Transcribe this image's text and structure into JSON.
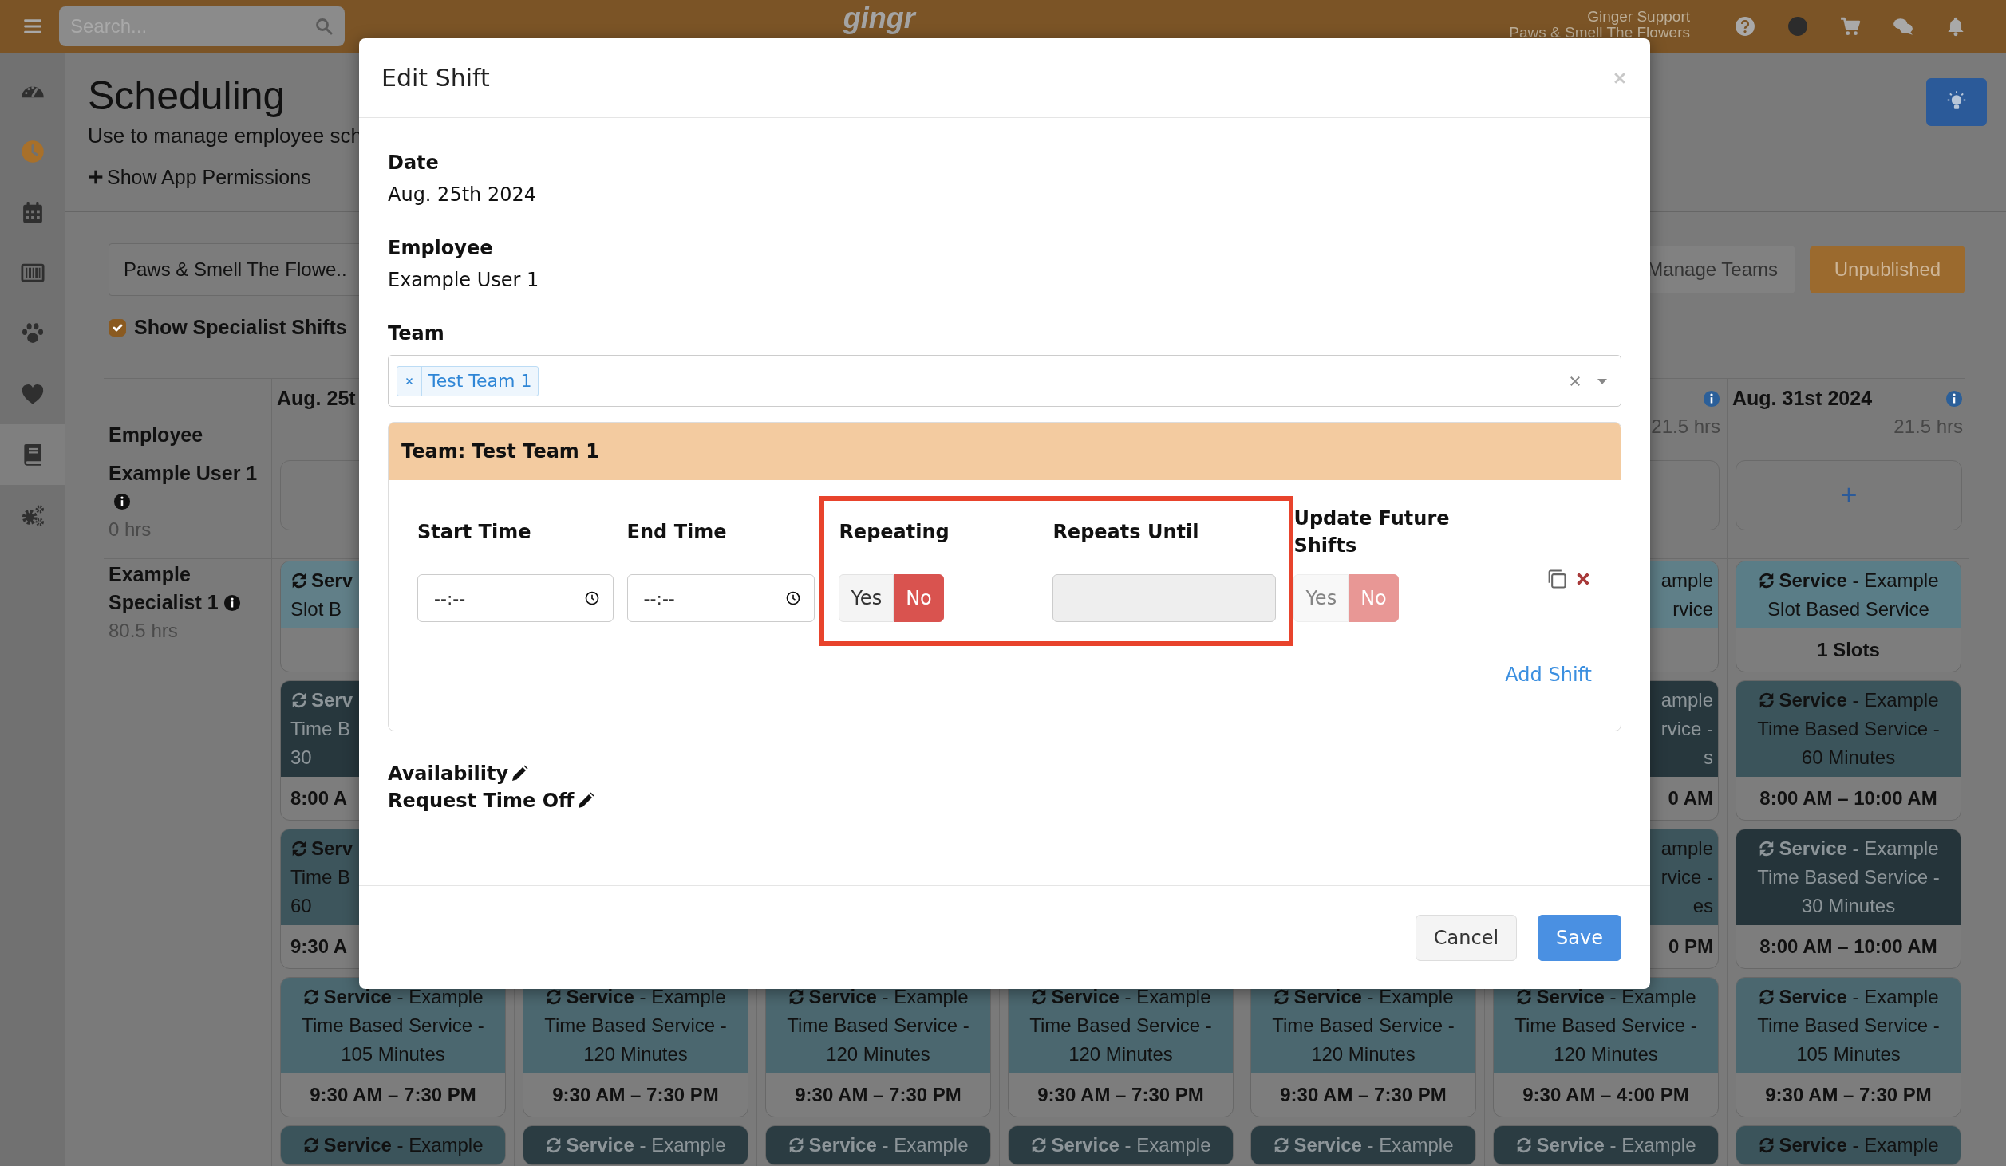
{
  "navbar": {
    "search": {
      "placeholder": "Search..."
    },
    "logo": "gingr",
    "account": {
      "name": "Ginger Support",
      "location": "Paws & Smell The Flowers"
    },
    "icons": [
      {
        "kind": "help"
      },
      {
        "kind": "avatar"
      },
      {
        "kind": "cart"
      },
      {
        "kind": "chat"
      },
      {
        "kind": "bell"
      }
    ]
  },
  "sidebar": {
    "items": [
      {
        "kind": "dashboard",
        "selected": false
      },
      {
        "kind": "clock",
        "selected": false
      },
      {
        "kind": "calendar",
        "selected": false
      },
      {
        "kind": "barcode",
        "selected": false
      },
      {
        "kind": "paw",
        "selected": false
      },
      {
        "kind": "heart",
        "selected": false
      },
      {
        "kind": "book",
        "selected": true
      },
      {
        "kind": "gears",
        "selected": false
      }
    ]
  },
  "header": {
    "title": "Scheduling",
    "subtitle": "Use to manage employee sch",
    "permissions_link": "Show App Permissions"
  },
  "filters": {
    "location": "Paws & Smell The Flowe..",
    "manage_teams": "Manage Teams",
    "status": "Unpublished",
    "show_specialist_shifts": {
      "label": "Show Specialist Shifts",
      "checked": true
    }
  },
  "schedule": {
    "employee_header": "Employee",
    "employees": [
      {
        "name": "Example User 1",
        "hours": "0 hrs",
        "info": true
      },
      {
        "name": "Example Specialist 1",
        "hours": "80.5 hrs",
        "info": true
      }
    ],
    "days": [
      {
        "date": "Aug. 25t",
        "user_cell": {
          "kind": "empty"
        },
        "shifts": [
          {
            "color": "#617f88",
            "repeating": true,
            "title": "**Serv**",
            "lines": [
              "Slot B"
            ]
          },
          {
            "color": "#27373d",
            "repeating": true,
            "title": "**Serv**",
            "lines": [
              "Time B",
              "30"
            ],
            "footer": "8:00 A"
          },
          {
            "color": "#3d555c",
            "repeating": true,
            "title": "**Serv**",
            "lines": [
              "Time B",
              "60"
            ],
            "footer": "9:30 A"
          },
          {
            "color": "#4b676f",
            "repeating": true,
            "title": "**Service** - Example",
            "lines": [
              "Time Based Service -",
              "105 Minutes"
            ],
            "footer": "9:30 AM – 7:30 PM"
          },
          {
            "color": "#3b545b",
            "repeating": true,
            "title": "**Service** - Example"
          }
        ]
      },
      {
        "shifts": [
          {
            "color": "#4b676f",
            "repeating": true,
            "title": "**Service** - Example",
            "lines": [
              "Time Based Service -",
              "120 Minutes"
            ],
            "footer": "9:30 AM – 7:30 PM"
          },
          {
            "color": "#2b3c42",
            "repeating": true,
            "title": "**Service** - Example"
          }
        ]
      },
      {
        "shifts": [
          {
            "color": "#4b676f",
            "repeating": true,
            "title": "**Service** - Example",
            "lines": [
              "Time Based Service -",
              "120 Minutes"
            ],
            "footer": "9:30 AM – 7:30 PM"
          },
          {
            "color": "#2b3c42",
            "repeating": true,
            "title": "**Service** - Example"
          }
        ]
      },
      {
        "shifts": [
          {
            "color": "#4b676f",
            "repeating": true,
            "title": "**Service** - Example",
            "lines": [
              "Time Based Service -",
              "120 Minutes"
            ],
            "footer": "9:30 AM – 7:30 PM"
          },
          {
            "color": "#2b3c42",
            "repeating": true,
            "title": "**Service** - Example"
          }
        ]
      },
      {
        "shifts": [
          {
            "color": "#4b676f",
            "repeating": true,
            "title": "**Service** - Example",
            "lines": [
              "Time Based Service -",
              "120 Minutes"
            ],
            "footer": "9:30 AM – 7:30 PM"
          },
          {
            "color": "#2b3c42",
            "repeating": true,
            "title": "**Service** - Example"
          }
        ]
      },
      {
        "hours": "21.5 hrs",
        "info": true,
        "user_cell": {
          "kind": "empty"
        },
        "shifts": [
          {
            "color": "#5f7f88",
            "title": "ample",
            "lines": [
              "rvice"
            ]
          },
          {
            "color": "#27373d",
            "title": "ample",
            "lines": [
              "rvice -",
              "s"
            ],
            "footer": "0 AM"
          },
          {
            "color": "#3d555c",
            "title": "ample",
            "lines": [
              "rvice -",
              "es"
            ],
            "footer": "0 PM"
          },
          {
            "color": "#4b676f",
            "repeating": true,
            "title": "**Service** - Example",
            "lines": [
              "Time Based Service -",
              "120 Minutes"
            ],
            "footer": "9:30 AM – 4:00 PM"
          },
          {
            "color": "#2b3c42",
            "repeating": true,
            "title": "**Service** - Example"
          }
        ]
      },
      {
        "date": "Aug. 31st 2024",
        "hours": "21.5 hrs",
        "info": true,
        "user_cell": {
          "kind": "add",
          "label": "+"
        },
        "shifts": [
          {
            "color": "#5a7d87",
            "repeating": true,
            "title": "**Service** - Example",
            "lines": [
              "Slot Based Service"
            ],
            "footer": "1 Slots"
          },
          {
            "color": "#3b545b",
            "repeating": true,
            "title": "**Service** - Example",
            "lines": [
              "Time Based Service -",
              "60 Minutes"
            ],
            "footer": "8:00 AM – 10:00 AM"
          },
          {
            "color": "#25343a",
            "repeating": true,
            "title": "**Service** - Example",
            "lines": [
              "Time Based Service -",
              "30 Minutes"
            ],
            "footer": "8:00 AM – 10:00 AM"
          },
          {
            "color": "#4b676f",
            "repeating": true,
            "title": "**Service** - Example",
            "lines": [
              "Time Based Service -",
              "105 Minutes"
            ],
            "footer": "9:30 AM – 7:30 PM"
          },
          {
            "color": "#3b545b",
            "repeating": true,
            "title": "**Service** - Example"
          }
        ]
      }
    ]
  },
  "modal": {
    "title": "Edit Shift",
    "fields": [
      {
        "label": "Date",
        "value": "Aug. 25th 2024"
      },
      {
        "label": "Employee",
        "value": "Example User 1"
      }
    ],
    "team": {
      "label": "Team",
      "chips": [
        "Test Team 1"
      ]
    },
    "team_panel": {
      "title": "Team: Test Team 1",
      "start_time": {
        "label": "Start Time",
        "placeholder": "--:--"
      },
      "end_time": {
        "label": "End Time",
        "placeholder": "--:--"
      },
      "repeat_group": {
        "highlighted": true,
        "repeating": {
          "label": "Repeating",
          "options": [
            {
              "label": "Yes",
              "selected": false
            },
            {
              "label": "No",
              "selected": true
            }
          ]
        },
        "repeats_until": {
          "label": "Repeats Until",
          "disabled": true
        }
      },
      "update_future": {
        "label": "Update Future Shifts",
        "disabled": true,
        "options": [
          {
            "label": "Yes",
            "selected": false
          },
          {
            "label": "No",
            "selected": true
          }
        ]
      },
      "add_shift": "Add Shift"
    },
    "links": [
      "Availability",
      "Request Time Off"
    ],
    "buttons": [
      {
        "label": "Cancel",
        "kind": "secondary"
      },
      {
        "label": "Save",
        "kind": "primary"
      }
    ]
  }
}
